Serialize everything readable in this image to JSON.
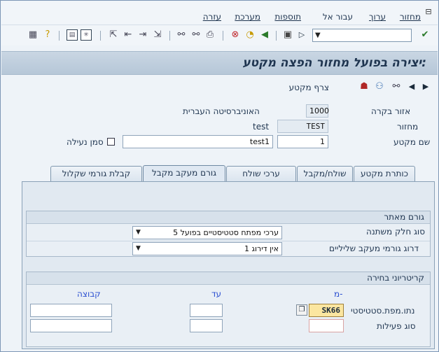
{
  "menubar": {
    "items": [
      "מחזור",
      "ערוך",
      "עבור אל",
      "תוספות",
      "מערכת",
      "עזרה"
    ],
    "window_icon": "window-menu-icon"
  },
  "toolbar": {
    "command_field_value": "",
    "icons": [
      "enter-check-icon",
      "save-icon",
      "back-icon",
      "exit-icon",
      "cancel-icon",
      "print-icon",
      "find-icon",
      "find-next-icon",
      "first-page-icon",
      "prev-page-icon",
      "next-page-icon",
      "last-page-icon",
      "new-session-icon",
      "shortcut-icon",
      "help-icon",
      "layout-icon"
    ]
  },
  "title": "יצירה בפועל מחזור הפצה מקטע:",
  "app_toolbar": {
    "attach_label": "צרף מקטע"
  },
  "header": {
    "area_label": "אזור בקרה",
    "area_value": "1000",
    "area_desc": "האוניברסיטה העברית",
    "cycle_label": "מחזור",
    "cycle_value": "TEST",
    "cycle_desc": "test",
    "segment_label": "שם מקטע",
    "segment_value": "1",
    "segment_desc": "test1",
    "lock_label": "סמן נעילה"
  },
  "tabs": [
    "כותרת מקטע",
    "שולח/מקבל",
    "ערכי שולח",
    "גורם מעקב מקבל",
    "קבלת גורמי שקלול"
  ],
  "active_tab": "גורם מעקב מקבל",
  "tracing_factor": {
    "group_title": "גורם מאתר",
    "variable_type_label": "סוג חלק משתנה",
    "variable_type_value": "5 ערכי מפתח סטטיסטיים בפועל",
    "scale_label": "דרוג גורמי מעקב שליליים",
    "scale_value": "1 אין דירוג"
  },
  "selection": {
    "group_title": "קריטריוני בחירה",
    "col_from": "מ-",
    "col_to": "עד",
    "col_group": "קבוצה",
    "row1_label": "נתו.מפת.סטטיסטי",
    "row1_from": "SK66",
    "row2_label": "סוג פעילות"
  }
}
